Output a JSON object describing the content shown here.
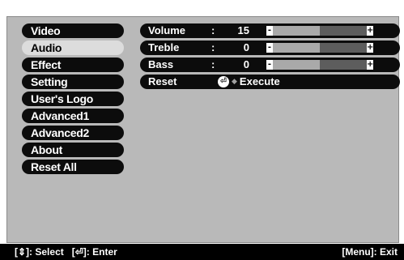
{
  "menu": [
    {
      "label": "Video",
      "selected": false
    },
    {
      "label": "Audio",
      "selected": true
    },
    {
      "label": "Effect",
      "selected": false
    },
    {
      "label": "Setting",
      "selected": false
    },
    {
      "label": "User's Logo",
      "selected": false
    },
    {
      "label": "Advanced1",
      "selected": false
    },
    {
      "label": "Advanced2",
      "selected": false
    },
    {
      "label": "About",
      "selected": false
    },
    {
      "label": "Reset All",
      "selected": false
    }
  ],
  "audio": {
    "volume": {
      "label": "Volume",
      "value": "15",
      "level_fraction": 0.5
    },
    "treble": {
      "label": "Treble",
      "value": "0",
      "level_fraction": 0.5
    },
    "bass": {
      "label": "Bass",
      "value": "0",
      "level_fraction": 0.5
    },
    "reset": {
      "label": "Reset",
      "action": "Execute"
    },
    "colon": ":",
    "minus": "-",
    "plus": "+"
  },
  "footer": {
    "select_keys": "[⇕]: Select",
    "enter_keys": "[⏎]: Enter",
    "exit_keys": "[Menu]: Exit"
  },
  "icons": {
    "enter": "enter-button-icon",
    "arrow": "right-arrow-icon",
    "updown": "up-down-arrow-icon"
  },
  "colors": {
    "panel": "#b9b9b9",
    "pill": "#0c0c0c",
    "selected": "#dcdcdc",
    "footer": "#000000"
  }
}
